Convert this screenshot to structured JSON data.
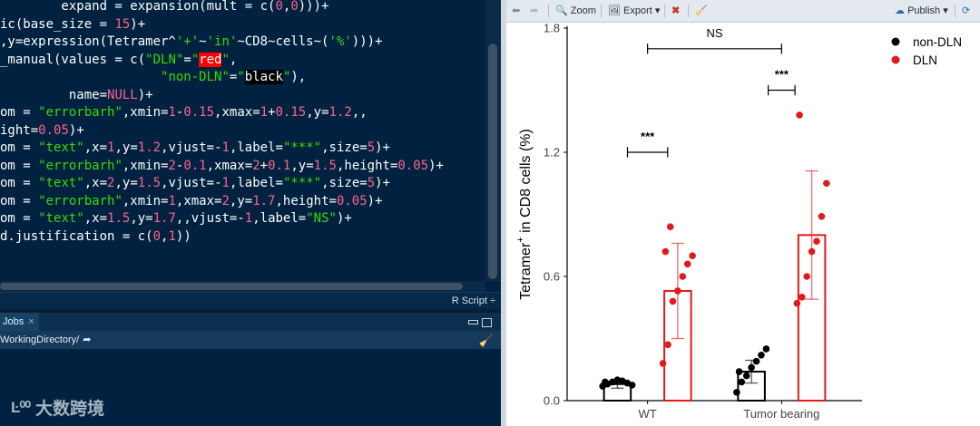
{
  "editor": {
    "lines": [
      [
        {
          "t": "        expand = expansion(mult = c(",
          "c": "id"
        },
        {
          "t": "0",
          "c": "num"
        },
        {
          "t": ",",
          "c": "op"
        },
        {
          "t": "0",
          "c": "num"
        },
        {
          "t": ")))+",
          "c": "op"
        }
      ],
      [
        {
          "t": "ic(base_size = ",
          "c": "id"
        },
        {
          "t": "15",
          "c": "num"
        },
        {
          "t": ")+",
          "c": "op"
        }
      ],
      [
        {
          "t": ",y=expression(Tetramer^",
          "c": "id"
        },
        {
          "t": "'+'",
          "c": "str"
        },
        {
          "t": "~",
          "c": "op"
        },
        {
          "t": "'in'",
          "c": "str"
        },
        {
          "t": "~CD8~cells~(",
          "c": "id"
        },
        {
          "t": "'%'",
          "c": "str"
        },
        {
          "t": ")))+",
          "c": "op"
        }
      ],
      [
        {
          "t": "_manual(values = c(",
          "c": "id"
        },
        {
          "t": "\"DLN\"",
          "c": "str"
        },
        {
          "t": "=",
          "c": "op"
        },
        {
          "t": "\"",
          "c": "str"
        },
        {
          "t": "red",
          "c": "hlred"
        },
        {
          "t": "\"",
          "c": "str"
        },
        {
          "t": ",",
          "c": "op"
        }
      ],
      [
        {
          "t": "                     ",
          "c": "id"
        },
        {
          "t": "\"non-DLN\"",
          "c": "str"
        },
        {
          "t": "=",
          "c": "op"
        },
        {
          "t": "\"",
          "c": "str"
        },
        {
          "t": "black",
          "c": "hlblk"
        },
        {
          "t": "\"",
          "c": "str"
        },
        {
          "t": "),",
          "c": "op"
        }
      ],
      [
        {
          "t": "         name=",
          "c": "id"
        },
        {
          "t": "NULL",
          "c": "num"
        },
        {
          "t": ")+",
          "c": "op"
        }
      ],
      [
        {
          "t": "om = ",
          "c": "id"
        },
        {
          "t": "\"errorbarh\"",
          "c": "str"
        },
        {
          "t": ",xmin=",
          "c": "id"
        },
        {
          "t": "1",
          "c": "num"
        },
        {
          "t": "-",
          "c": "op"
        },
        {
          "t": "0.15",
          "c": "num"
        },
        {
          "t": ",xmax=",
          "c": "id"
        },
        {
          "t": "1",
          "c": "num"
        },
        {
          "t": "+",
          "c": "op"
        },
        {
          "t": "0.15",
          "c": "num"
        },
        {
          "t": ",y=",
          "c": "id"
        },
        {
          "t": "1.2",
          "c": "num"
        },
        {
          "t": ",,",
          "c": "op"
        }
      ],
      [
        {
          "t": "ight=",
          "c": "id"
        },
        {
          "t": "0.05",
          "c": "num"
        },
        {
          "t": ")+",
          "c": "op"
        }
      ],
      [
        {
          "t": "om = ",
          "c": "id"
        },
        {
          "t": "\"text\"",
          "c": "str"
        },
        {
          "t": ",x=",
          "c": "id"
        },
        {
          "t": "1",
          "c": "num"
        },
        {
          "t": ",y=",
          "c": "id"
        },
        {
          "t": "1.2",
          "c": "num"
        },
        {
          "t": ",vjust=-",
          "c": "id"
        },
        {
          "t": "1",
          "c": "num"
        },
        {
          "t": ",label=",
          "c": "id"
        },
        {
          "t": "\"***\"",
          "c": "str"
        },
        {
          "t": ",size=",
          "c": "id"
        },
        {
          "t": "5",
          "c": "num"
        },
        {
          "t": ")+",
          "c": "op"
        }
      ],
      [
        {
          "t": "om = ",
          "c": "id"
        },
        {
          "t": "\"errorbarh\"",
          "c": "str"
        },
        {
          "t": ",xmin=",
          "c": "id"
        },
        {
          "t": "2",
          "c": "num"
        },
        {
          "t": "-",
          "c": "op"
        },
        {
          "t": "0.1",
          "c": "num"
        },
        {
          "t": ",xmax=",
          "c": "id"
        },
        {
          "t": "2",
          "c": "num"
        },
        {
          "t": "+",
          "c": "op"
        },
        {
          "t": "0.1",
          "c": "num"
        },
        {
          "t": ",y=",
          "c": "id"
        },
        {
          "t": "1.5",
          "c": "num"
        },
        {
          "t": ",height=",
          "c": "id"
        },
        {
          "t": "0.05",
          "c": "num"
        },
        {
          "t": ")+",
          "c": "op"
        }
      ],
      [
        {
          "t": "om = ",
          "c": "id"
        },
        {
          "t": "\"text\"",
          "c": "str"
        },
        {
          "t": ",x=",
          "c": "id"
        },
        {
          "t": "2",
          "c": "num"
        },
        {
          "t": ",y=",
          "c": "id"
        },
        {
          "t": "1.5",
          "c": "num"
        },
        {
          "t": ",vjust=-",
          "c": "id"
        },
        {
          "t": "1",
          "c": "num"
        },
        {
          "t": ",label=",
          "c": "id"
        },
        {
          "t": "\"***\"",
          "c": "str"
        },
        {
          "t": ",size=",
          "c": "id"
        },
        {
          "t": "5",
          "c": "num"
        },
        {
          "t": ")+",
          "c": "op"
        }
      ],
      [
        {
          "t": "om = ",
          "c": "id"
        },
        {
          "t": "\"errorbarh\"",
          "c": "str"
        },
        {
          "t": ",xmin=",
          "c": "id"
        },
        {
          "t": "1",
          "c": "num"
        },
        {
          "t": ",xmax=",
          "c": "id"
        },
        {
          "t": "2",
          "c": "num"
        },
        {
          "t": ",y=",
          "c": "id"
        },
        {
          "t": "1.7",
          "c": "num"
        },
        {
          "t": ",height=",
          "c": "id"
        },
        {
          "t": "0.05",
          "c": "num"
        },
        {
          "t": ")+",
          "c": "op"
        }
      ],
      [
        {
          "t": "om = ",
          "c": "id"
        },
        {
          "t": "\"text\"",
          "c": "str"
        },
        {
          "t": ",x=",
          "c": "id"
        },
        {
          "t": "1.5",
          "c": "num"
        },
        {
          "t": ",y=",
          "c": "id"
        },
        {
          "t": "1.7",
          "c": "num"
        },
        {
          "t": ",,vjust=-",
          "c": "id"
        },
        {
          "t": "1",
          "c": "num"
        },
        {
          "t": ",label=",
          "c": "id"
        },
        {
          "t": "\"NS\"",
          "c": "str"
        },
        {
          "t": ")+",
          "c": "op"
        }
      ],
      [
        {
          "t": "d.justification = c(",
          "c": "id"
        },
        {
          "t": "0",
          "c": "num"
        },
        {
          "t": ",",
          "c": "op"
        },
        {
          "t": "1",
          "c": "num"
        },
        {
          "t": "))",
          "c": "op"
        }
      ]
    ],
    "status": {
      "script_type": "R Script ÷"
    }
  },
  "console": {
    "tab_label": "Jobs",
    "tab_close": "×",
    "working_dir": "WorkingDirectory/",
    "arrow_icon": "go-to-directory-icon",
    "broom_icon": "clear-console-icon"
  },
  "watermark": {
    "logo_text": "Ŀ⁰⁰",
    "text": "大数跨境"
  },
  "plots_toolbar": {
    "zoom_label": "Zoom",
    "export_label": "Export",
    "export_caret": "▾",
    "publish_label": "Publish",
    "publish_caret": "▾",
    "icons": [
      "back-arrow-icon",
      "forward-arrow-icon",
      "zoom-icon",
      "export-icon",
      "remove-plot-icon",
      "broom-icon",
      "publish-icon",
      "refresh-icon"
    ]
  },
  "colors": {
    "editor_bg": "#002240",
    "string": "#3ad900",
    "number": "#ff628c",
    "dln": "#e31a1c",
    "non_dln": "#000000"
  },
  "chart_data": {
    "type": "bar",
    "categories": [
      "WT",
      "Tumor bearing"
    ],
    "xlabel": "",
    "ylabel": "Tetramer+ in CD8 cells (%)",
    "ylabel_parts": {
      "main": "Tetramer",
      "sup": "+",
      "rest": " in CD8 cells (%)"
    },
    "ylim": [
      0,
      1.8
    ],
    "yticks": [
      "0.0",
      "0.6",
      "1.2",
      "1.8"
    ],
    "legend": {
      "placement": "top-right",
      "entries": [
        {
          "name": "non-DLN",
          "color": "#000000"
        },
        {
          "name": "DLN",
          "color": "#e31a1c"
        }
      ]
    },
    "series": [
      {
        "name": "non-DLN",
        "color": "#000000",
        "values": [
          0.08,
          0.14
        ],
        "err": [
          0.02,
          0.055
        ],
        "points": [
          [
            0.07,
            0.08,
            0.09,
            0.1,
            0.095,
            0.085,
            0.075,
            0.09
          ],
          [
            0.04,
            0.09,
            0.12,
            0.16,
            0.19,
            0.22,
            0.25,
            0.14
          ]
        ]
      },
      {
        "name": "DLN",
        "color": "#e31a1c",
        "values": [
          0.53,
          0.8
        ],
        "err": [
          0.23,
          0.31
        ],
        "points": [
          [
            0.18,
            0.27,
            0.48,
            0.53,
            0.6,
            0.66,
            0.7,
            0.72,
            0.84
          ],
          [
            0.47,
            0.5,
            0.6,
            0.72,
            0.77,
            0.89,
            1.05,
            1.38
          ]
        ]
      }
    ],
    "annotations": [
      {
        "label": "***",
        "x_center": 1,
        "y": 1.2,
        "xmin": 0.85,
        "xmax": 1.15
      },
      {
        "label": "***",
        "x_center": 2,
        "y": 1.5,
        "xmin": 1.9,
        "xmax": 2.1
      },
      {
        "label": "NS",
        "x_center": 1.5,
        "y": 1.7,
        "xmin": 1,
        "xmax": 2
      }
    ]
  }
}
